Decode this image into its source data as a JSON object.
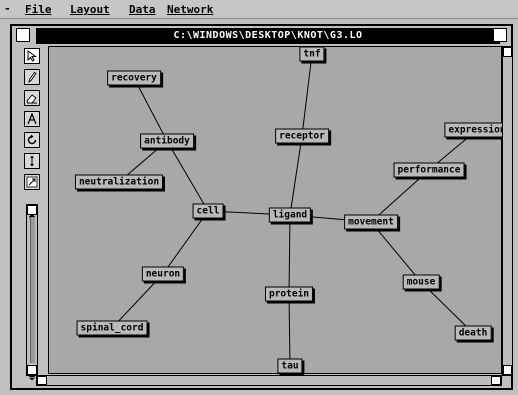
{
  "menu": {
    "system": "-",
    "items": [
      {
        "label": "File",
        "accel": "F"
      },
      {
        "label": "Layout",
        "accel": "L"
      },
      {
        "label": "Data",
        "accel": "D"
      },
      {
        "label": "Network",
        "accel": "N"
      }
    ]
  },
  "window": {
    "title": "C:\\WINDOWS\\DESKTOP\\KNOT\\G3.LO"
  },
  "toolbar": {
    "tools": [
      "pointer-icon",
      "pencil-icon",
      "eraser-icon",
      "text-icon",
      "rotate-icon",
      "move-icon",
      "resize-icon"
    ]
  },
  "graph": {
    "nodes": [
      {
        "id": "tnf",
        "label": "tnf"
      },
      {
        "id": "recovery",
        "label": "recovery"
      },
      {
        "id": "receptor",
        "label": "receptor"
      },
      {
        "id": "expression",
        "label": "expression"
      },
      {
        "id": "antibody",
        "label": "antibody"
      },
      {
        "id": "performance",
        "label": "performance"
      },
      {
        "id": "neutralization",
        "label": "neutralization"
      },
      {
        "id": "cell",
        "label": "cell"
      },
      {
        "id": "ligand",
        "label": "ligand"
      },
      {
        "id": "movement",
        "label": "movement"
      },
      {
        "id": "neuron",
        "label": "neuron"
      },
      {
        "id": "mouse",
        "label": "mouse"
      },
      {
        "id": "protein",
        "label": "protein"
      },
      {
        "id": "spinal_cord",
        "label": "spinal_cord"
      },
      {
        "id": "death",
        "label": "death"
      },
      {
        "id": "tau",
        "label": "tau"
      }
    ],
    "edges": [
      [
        "recovery",
        "antibody"
      ],
      [
        "antibody",
        "neutralization"
      ],
      [
        "antibody",
        "cell"
      ],
      [
        "cell",
        "neuron"
      ],
      [
        "neuron",
        "spinal_cord"
      ],
      [
        "cell",
        "ligand"
      ],
      [
        "tnf",
        "receptor"
      ],
      [
        "receptor",
        "ligand"
      ],
      [
        "ligand",
        "movement"
      ],
      [
        "ligand",
        "protein"
      ],
      [
        "protein",
        "tau"
      ],
      [
        "movement",
        "performance"
      ],
      [
        "performance",
        "expression"
      ],
      [
        "movement",
        "mouse"
      ],
      [
        "mouse",
        "death"
      ]
    ]
  },
  "colors": {
    "canvas": "#a8a8a8",
    "node_fill": "#bababa",
    "titlebar": "#000000"
  }
}
